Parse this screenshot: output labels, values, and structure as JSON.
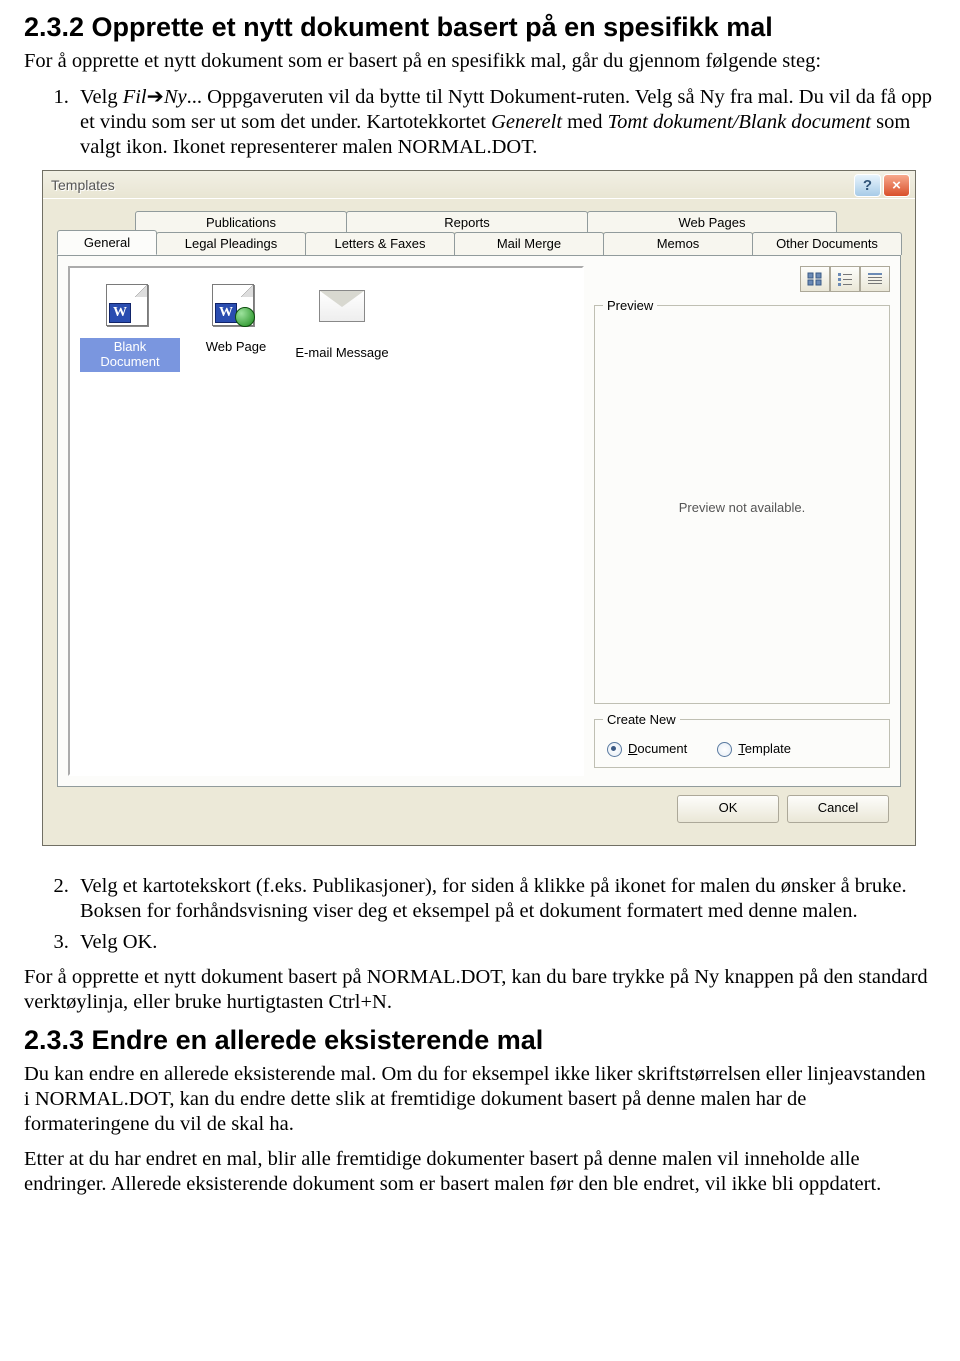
{
  "section232": {
    "heading": "2.3.2 Opprette et nytt dokument basert på en spesifikk mal",
    "intro": "For å opprette et nytt dokument som er basert på en spesifikk mal, går du gjennom følgende steg:",
    "step1_a": "Velg ",
    "step1_b": "Fil",
    "step1_arrow": "➔",
    "step1_c": "Ny",
    "step1_d": "... Oppgaveruten vil da bytte til Nytt Dokument-ruten. Velg så Ny fra mal. Du vil da få opp et vindu som ser ut som det under. Kartotekkortet ",
    "step1_e": "Generelt",
    "step1_f": " med ",
    "step1_g": "Tomt dokument/Blank document",
    "step1_h": " som valgt ikon. Ikonet representerer malen NORMAL.DOT.",
    "step2": "Velg et kartotekskort (f.eks. Publikasjoner), for siden å klikke på ikonet for malen du ønsker å bruke. Boksen for forhåndsvisning viser deg et eksempel på et dokument formatert med denne malen.",
    "step3": "Velg OK.",
    "after": "For å opprette et nytt dokument basert på NORMAL.DOT, kan du bare trykke på Ny knappen på den standard verktøylinja, eller bruke hurtigtasten Ctrl+N."
  },
  "section233": {
    "heading": "2.3.3 Endre en allerede eksisterende mal",
    "p1": "Du kan endre en allerede eksisterende mal. Om du for eksempel ikke liker skriftstørrelsen eller linjeavstanden i NORMAL.DOT, kan du endre dette slik at fremtidige dokument basert på denne malen har de formateringene du vil de skal ha.",
    "p2": "Etter at du har endret en mal, blir alle fremtidige dokumenter basert på denne malen vil inneholde alle endringer. Allerede eksisterende dokument som er basert malen før den ble endret, vil ikke bli oppdatert."
  },
  "dialog": {
    "title": "Templates",
    "tabs_top": [
      "Publications",
      "Reports",
      "Web Pages"
    ],
    "tabs_bottom": [
      "General",
      "Legal Pleadings",
      "Letters & Faxes",
      "Mail Merge",
      "Memos",
      "Other Documents"
    ],
    "items": [
      {
        "label": "Blank Document",
        "selected": true,
        "kind": "word"
      },
      {
        "label": "Web Page",
        "selected": false,
        "kind": "web"
      },
      {
        "label": "E-mail Message",
        "selected": false,
        "kind": "mail"
      }
    ],
    "preview_legend": "Preview",
    "preview_text": "Preview not available.",
    "createnew_legend": "Create New",
    "radio_doc": "Document",
    "radio_tpl": "Template",
    "ok": "OK",
    "cancel": "Cancel"
  }
}
